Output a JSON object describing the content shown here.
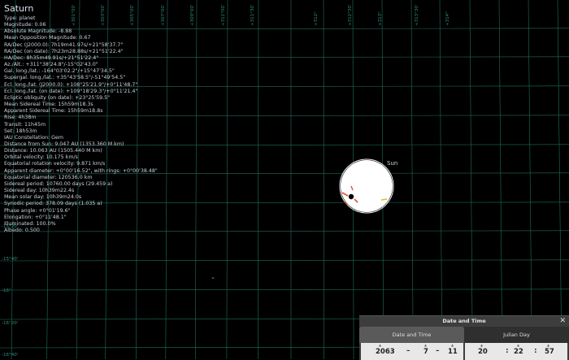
{
  "object": {
    "title": "Saturn",
    "lines": [
      "Type: planet",
      "Magnitude: 0.06",
      "Absolute Magnitude: -8.88",
      "Mean Opposition Magnitude: 0.67",
      "RA/Dec (J2000.0): 7h19m41.97s/+21°58'37.7\"",
      "RA/Dec (on date): 7h23m28.88s/+21°51'22.4\"",
      "HA/Dec: 8h35m49.91s/+21°51'22.4\"",
      "Az./Alt.: +311°38'24.8\"/-15°02'43.0\"",
      "Gal. long./lat.: -164°03'02.2\"/+15°47'34.5\"",
      "Supergal. long./lat.: +35°43'58.5\"/-51°49'54.5\"",
      "Ecl. long./lat. (J2000.0): +108°25'21.9\"/+0°11'48.7\"",
      "Ecl. long./lat. (on date): +109°18'29.3\"/+0°11'21.4\"",
      "Ecliptic obliquity (on date): +23°25'59.5\"",
      "Mean Sidereal Time: 15h59m18.3s",
      "Apparent Sidereal Time: 15h59m18.8s",
      "Rise: 4h38m",
      "Transit: 11h45m",
      "Set: 18h53m",
      "IAU Constellation: Gem",
      "Distance from Sun: 9.047 AU (1353.360 M km)",
      "Distance: 10.063 AU (1505.440 M km)",
      "Orbital velocity: 10.175 km/s",
      "Equatorial rotation velocity: 9.871 km/s",
      "Apparent diameter: +0°00'16.52\", with rings: +0°00'38.48\"",
      "Equatorial diameter: 120536.0 km",
      "Sidereal period: 10760.00 days (29.459 a)",
      "Sidereal day: 10h39m22.4s",
      "Mean solar day: 10h39m24.0s",
      "Synodic period: 378.09 days (1.035 a)",
      "Phase angle: +0°01'19.6\"",
      "Elongation: +0°11'48.1\"",
      "Illuminated: 100.0%",
      "Albedo: 0.500"
    ]
  },
  "sun_label": "Sun",
  "grid": {
    "color": "#1f6e5e",
    "top_ticks": [
      "+301°00'",
      "+303°00'",
      "+305°00'",
      "+307°00'",
      "+309°00'",
      "+311°00'",
      "+311°30'",
      "+312°",
      "+312°30'",
      "+313°",
      "+313°30'",
      "+314°"
    ],
    "left_ticks": [
      "-15°20'",
      "-15°40'",
      "-16°",
      "-16°20'",
      "-16°40'"
    ]
  },
  "datetime": {
    "title": "Date and Time",
    "close_icon": "close-icon",
    "tab_date": "Date and Time",
    "tab_julian": "Julian Day",
    "year": "2063",
    "month": "7",
    "day": "11",
    "hour": "20",
    "minute": "22",
    "second": "57",
    "date_sep": "–",
    "time_sep": ":"
  },
  "colors": {
    "background": "#000000",
    "panel": "#3d3d3d",
    "grid": "#1f6e5e",
    "tick_text": "#2e8f7a"
  }
}
